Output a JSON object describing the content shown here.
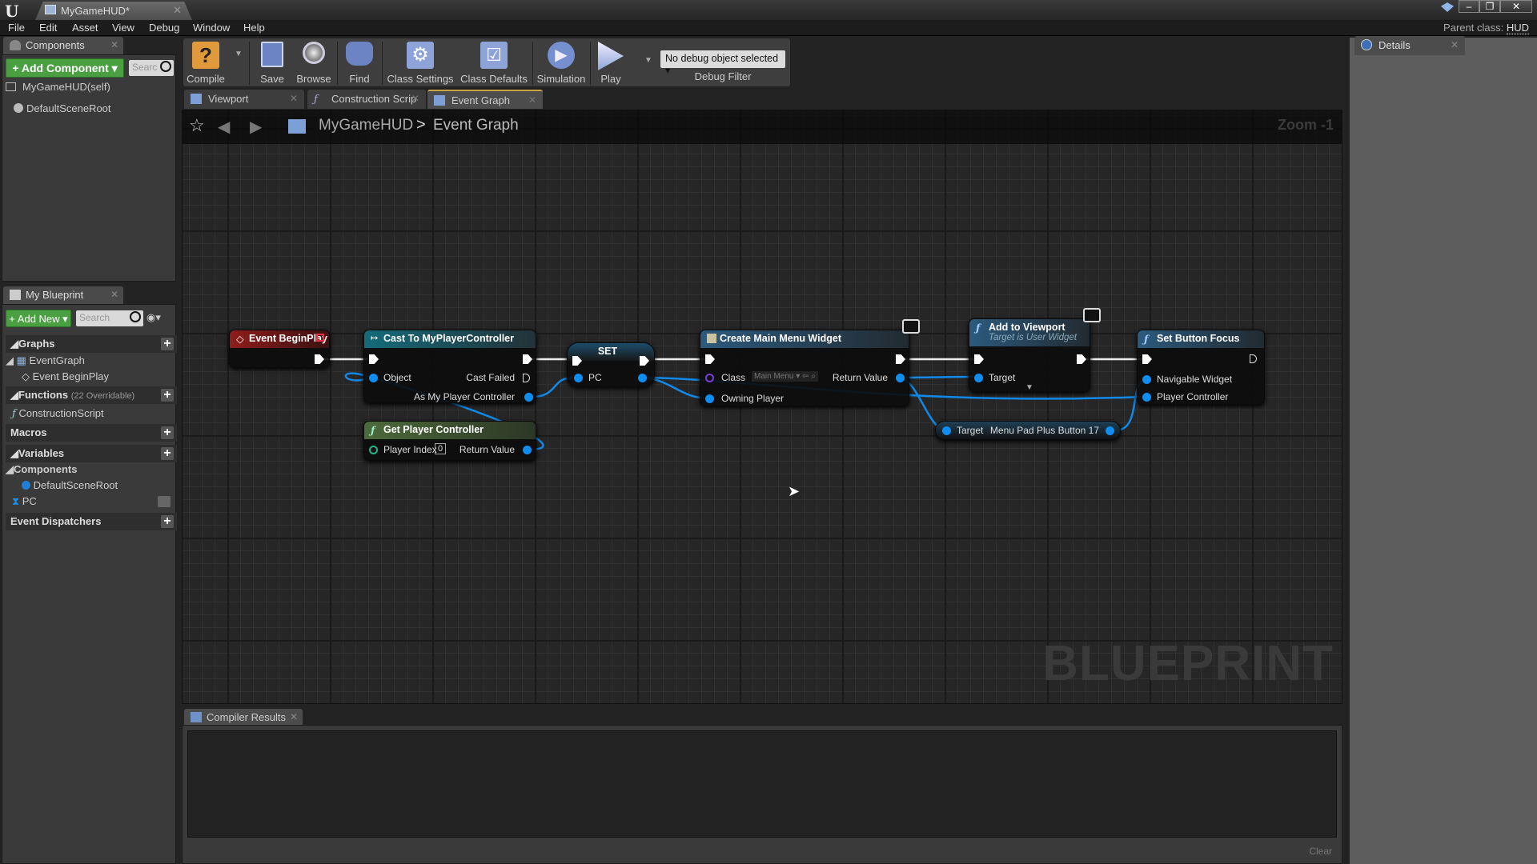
{
  "window": {
    "doc_tab_title": "MyGameHUD*",
    "parent_class_label": "Parent class:",
    "parent_class_value": "HUD",
    "controls": [
      "minimize",
      "restore",
      "close"
    ]
  },
  "menu": [
    "File",
    "Edit",
    "Asset",
    "View",
    "Debug",
    "Window",
    "Help"
  ],
  "components_panel": {
    "tab_label": "Components",
    "add_button": "Add Component",
    "search_placeholder": "Searc",
    "items": [
      {
        "label": "MyGameHUD(self)",
        "icon": "actor-icon"
      },
      {
        "label": "DefaultSceneRoot",
        "icon": "scene-component-icon"
      }
    ]
  },
  "my_blueprint": {
    "tab_label": "My Blueprint",
    "add_button": "Add New",
    "search_placeholder": "Search",
    "sections": {
      "graphs": "Graphs",
      "graph_item": "EventGraph",
      "graph_child": "Event BeginPlay",
      "functions": "Functions",
      "functions_note": "(22 Overridable)",
      "function_item": "ConstructionScript",
      "macros": "Macros",
      "variables": "Variables",
      "var_category": "Components",
      "var_items": [
        "DefaultSceneRoot",
        "PC"
      ],
      "dispatchers": "Event Dispatchers"
    }
  },
  "toolbar": {
    "buttons": [
      "Compile",
      "Save",
      "Browse",
      "Find",
      "Class Settings",
      "Class Defaults",
      "Simulation",
      "Play"
    ],
    "debug_select": "No debug object selected",
    "debug_filter_label": "Debug Filter"
  },
  "editor_tabs": [
    {
      "label": "Viewport",
      "active": false
    },
    {
      "label": "Construction Scrip",
      "active": false
    },
    {
      "label": "Event Graph",
      "active": true
    }
  ],
  "graph": {
    "breadcrumb_root": "MyGameHUD",
    "breadcrumb_sep": ">",
    "breadcrumb_leaf": "Event Graph",
    "zoom_label": "Zoom -1",
    "watermark": "BLUEPRINT",
    "nodes": {
      "begin_play": {
        "title": "Event BeginPlay"
      },
      "cast": {
        "title": "Cast To MyPlayerController",
        "pins": [
          "Object",
          "Cast Failed",
          "As My Player Controller"
        ]
      },
      "get_pc": {
        "title": "Get Player Controller",
        "pins": [
          "Player Index",
          "Return Value"
        ],
        "player_index": "0"
      },
      "set": {
        "title": "SET",
        "pins": [
          "PC"
        ]
      },
      "create_widget": {
        "title": "Create Main Menu Widget",
        "pins": [
          "Class",
          "Owning Player",
          "Return Value"
        ],
        "class_value": "Main Menu"
      },
      "add_viewport": {
        "title": "Add to Viewport",
        "subtitle": "Target is User Widget",
        "pins": [
          "Target"
        ]
      },
      "button_getter": {
        "pins": [
          "Target",
          "Menu Pad Plus Button 17"
        ]
      },
      "set_focus": {
        "title": "Set Button Focus",
        "pins": [
          "Navigable Widget",
          "Player Controller"
        ]
      }
    }
  },
  "details": {
    "tab_label": "Details"
  },
  "compiler": {
    "tab_label": "Compiler Results",
    "clear_label": "Clear"
  }
}
